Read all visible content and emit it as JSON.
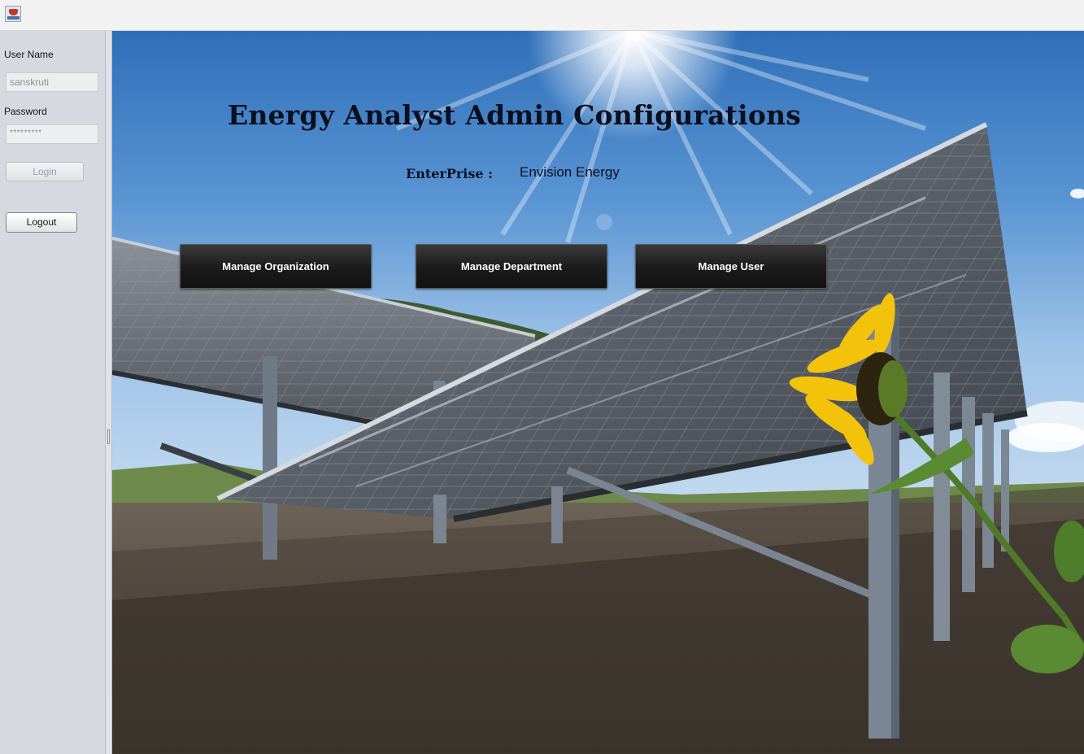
{
  "window": {
    "icon": "java-app-icon"
  },
  "login": {
    "username_label": "User Name",
    "username_value": "sanskruti",
    "password_label": "Password",
    "password_value": "*********",
    "login_button": "Login",
    "logout_button": "Logout"
  },
  "main": {
    "title": "Energy Analyst Admin Configurations",
    "enterprise_label": "EnterPrise :",
    "enterprise_value": "Envision Energy",
    "buttons": {
      "organization": "Manage Organization",
      "department": "Manage Department",
      "user": "Manage User"
    }
  },
  "colors": {
    "left_panel_bg": "#d6dae0",
    "button_dark": "#1f1f1f",
    "title_text": "#0a0f1e",
    "sky": "#3e7bc0"
  }
}
